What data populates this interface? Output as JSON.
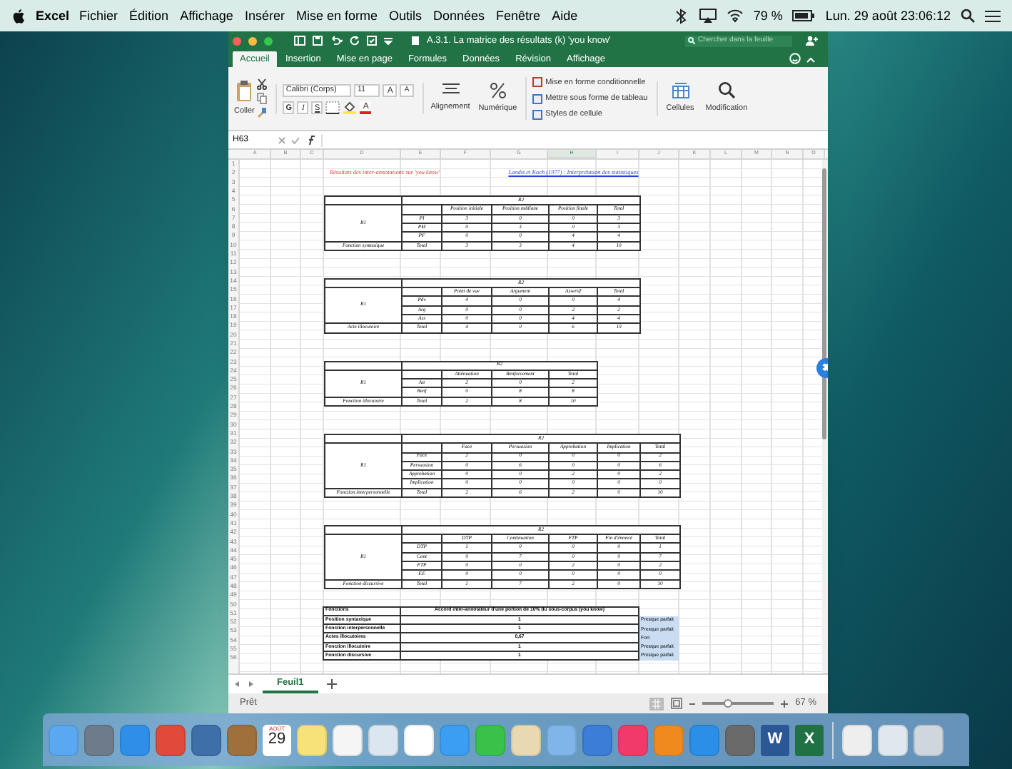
{
  "menu_bar": {
    "app": "Excel",
    "items": [
      "Fichier",
      "Édition",
      "Affichage",
      "Insérer",
      "Mise en forme",
      "Outils",
      "Données",
      "Fenêtre",
      "Aide"
    ],
    "battery": "79 %",
    "clock": "Lun. 29 août 23:06:12"
  },
  "window": {
    "title": "A.3.1. La matrice des résultats (k) 'you know'",
    "search": {
      "placeholder": "Chercher dans la feuille"
    }
  },
  "tabs": [
    {
      "label": "Accueil",
      "selected": true
    },
    {
      "label": "Insertion",
      "selected": false
    },
    {
      "label": "Mise en page",
      "selected": false
    },
    {
      "label": "Formules",
      "selected": false
    },
    {
      "label": "Données",
      "selected": false
    },
    {
      "label": "Révision",
      "selected": false
    },
    {
      "label": "Affichage",
      "selected": false
    }
  ],
  "ribbon": {
    "paste": "Coller",
    "font": "Calibri (Corps)",
    "size": "11",
    "grow": "A",
    "shrink": "A",
    "bold": "G",
    "italic": "I",
    "underline": "S",
    "font_color": "A",
    "alignment": "Alignement",
    "number": "Numérique",
    "styles": [
      "Mise en forme conditionnelle",
      "Mettre sous forme de tableau",
      "Styles de cellule"
    ],
    "cells": "Cellules",
    "editing": "Modification"
  },
  "formula_bar": {
    "cell": "H63"
  },
  "sheet": {
    "columns": [
      {
        "label": "A",
        "selected": false
      },
      {
        "label": "B",
        "selected": false
      },
      {
        "label": "C",
        "selected": false
      },
      {
        "label": "D",
        "selected": false
      },
      {
        "label": "E",
        "selected": false
      },
      {
        "label": "F",
        "selected": false
      },
      {
        "label": "G",
        "selected": false
      },
      {
        "label": "H",
        "selected": true
      },
      {
        "label": "I",
        "selected": false
      },
      {
        "label": "J",
        "selected": false
      },
      {
        "label": "K",
        "selected": false
      },
      {
        "label": "L",
        "selected": false
      },
      {
        "label": "M",
        "selected": false
      },
      {
        "label": "N",
        "selected": false
      },
      {
        "label": "O",
        "selected": false
      }
    ],
    "row_numbers": [
      "1",
      "2",
      "3",
      "4",
      "5",
      "6",
      "7",
      "8",
      "9",
      "10",
      "11",
      "12",
      "13",
      "14",
      "15",
      "16",
      "17",
      "18",
      "19",
      "20",
      "21",
      "22",
      "23",
      "24",
      "25",
      "26",
      "27",
      "28",
      "29",
      "30",
      "31",
      "32",
      "33",
      "34",
      "35",
      "36",
      "37",
      "38",
      "39",
      "40",
      "41",
      "42",
      "43",
      "44",
      "45",
      "46",
      "47",
      "48",
      "49",
      "50",
      "51",
      "52",
      "53",
      "54",
      "55",
      "56"
    ],
    "title": "Résultats des inter-annotations sur 'you know'",
    "link": "Landis et Koch (1977) : Interprétation des statistiques",
    "tables": [
      {
        "header": "R2",
        "corner": "R1",
        "columns": [
          "Position initiale",
          "Position médiane",
          "Position finale",
          "Total"
        ],
        "rows": [
          {
            "label": "PI",
            "values": [
              "3",
              "0",
              "0",
              "3"
            ]
          },
          {
            "label": "PM",
            "values": [
              "0",
              "3",
              "0",
              "3"
            ]
          },
          {
            "label": "PF",
            "values": [
              "0",
              "0",
              "4",
              "4"
            ]
          }
        ],
        "total": {
          "label": "Total",
          "values": [
            "3",
            "3",
            "4",
            "10"
          ]
        },
        "caption": "Fonction syntaxique"
      },
      {
        "header": "R2",
        "corner": "R1",
        "columns": [
          "Point de vue",
          "Argument",
          "Assertif",
          "Total"
        ],
        "rows": [
          {
            "label": "Pdv",
            "values": [
              "4",
              "0",
              "0",
              "4"
            ]
          },
          {
            "label": "Arg",
            "values": [
              "0",
              "0",
              "2",
              "2"
            ]
          },
          {
            "label": "Ass",
            "values": [
              "0",
              "0",
              "4",
              "4"
            ]
          }
        ],
        "total": {
          "label": "Total",
          "values": [
            "4",
            "0",
            "6",
            "10"
          ]
        },
        "caption": "Acte illocutoire"
      },
      {
        "header": "R2",
        "corner": "R1",
        "columns": [
          "Atténuation",
          "Renforcement",
          "Total"
        ],
        "rows": [
          {
            "label": "Att",
            "values": [
              "2",
              "0",
              "2"
            ]
          },
          {
            "label": "Renf",
            "values": [
              "0",
              "8",
              "8"
            ]
          }
        ],
        "total": {
          "label": "Total",
          "values": [
            "2",
            "8",
            "10"
          ]
        },
        "caption": "Fonction illocutoire"
      },
      {
        "header": "R2",
        "corner": "R1",
        "columns": [
          "Face",
          "Persuasion",
          "Approbation",
          "Implication",
          "Total"
        ],
        "rows": [
          {
            "label": "Face",
            "values": [
              "2",
              "0",
              "0",
              "0",
              "2"
            ]
          },
          {
            "label": "Persuasion",
            "values": [
              "0",
              "6",
              "0",
              "0",
              "6"
            ]
          },
          {
            "label": "Approbation",
            "values": [
              "0",
              "0",
              "2",
              "0",
              "2"
            ]
          },
          {
            "label": "Implication",
            "values": [
              "0",
              "0",
              "0",
              "0",
              "0"
            ]
          }
        ],
        "total": {
          "label": "Total",
          "values": [
            "2",
            "6",
            "2",
            "0",
            "10"
          ]
        },
        "caption": "Fonction interpersonnelle"
      },
      {
        "header": "R2",
        "corner": "R1",
        "columns": [
          "DTP",
          "Continuation",
          "FTP",
          "Fin d'énoncé",
          "Total"
        ],
        "rows": [
          {
            "label": "DTP",
            "values": [
              "1",
              "0",
              "0",
              "0",
              "1"
            ]
          },
          {
            "label": "Cont",
            "values": [
              "0",
              "7",
              "0",
              "0",
              "7"
            ]
          },
          {
            "label": "FTP",
            "values": [
              "0",
              "0",
              "2",
              "0",
              "2"
            ]
          },
          {
            "label": "F.E",
            "values": [
              "0",
              "0",
              "0",
              "0",
              "0"
            ]
          }
        ],
        "total": {
          "label": "Total",
          "values": [
            "1",
            "7",
            "2",
            "0",
            "10"
          ]
        },
        "caption": "Fonction discursive"
      }
    ],
    "summary": {
      "columns": [
        "Fonctions",
        "Accord inter-annotateur d'une portion de 10% du sous-corpus (you know)"
      ],
      "rows": [
        {
          "function": "Position syntaxique",
          "value": "1",
          "rating": "Presque parfait"
        },
        {
          "function": "Fonction interpersonnelle",
          "value": "1",
          "rating": "Presque parfait"
        },
        {
          "function": "Actes illocutoires",
          "value": "0,67",
          "rating": "Fort"
        },
        {
          "function": "Fonction illocutoire",
          "value": "1",
          "rating": "Presque parfait"
        },
        {
          "function": "Fonction discursive",
          "value": "1",
          "rating": "Presque parfait"
        }
      ]
    }
  },
  "sheet_tabs": [
    {
      "label": "Feuil1",
      "selected": true
    }
  ],
  "status_bar": {
    "status": "Prêt",
    "zoom": "67 %",
    "level": 0.35
  },
  "dock": {
    "calendar_month": "AOÛT",
    "calendar_day": "29",
    "word_letter": "W",
    "excel_letter": "X"
  }
}
